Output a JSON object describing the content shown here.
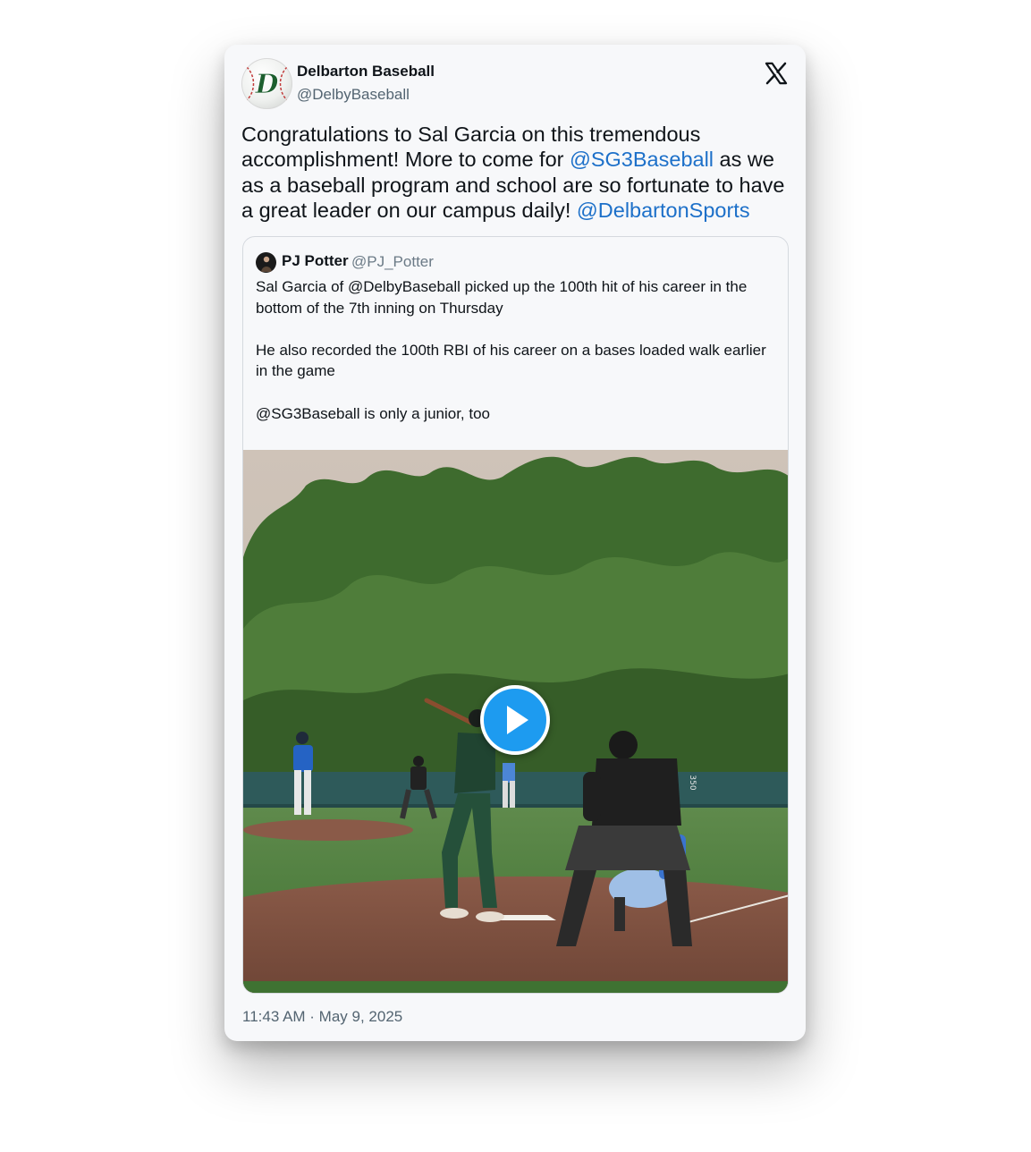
{
  "author": {
    "name": "Delbarton Baseball",
    "handle": "@DelbyBaseball",
    "avatar_icon": "delbarton-d-baseball-logo",
    "avatar_letter": "D"
  },
  "platform_icon": "x-logo-icon",
  "tweet": {
    "segments": [
      {
        "text": "Congratulations to Sal Garcia on this tremendous accomplishment! More to come for ",
        "type": "text"
      },
      {
        "text": "@SG3Baseball",
        "type": "mention"
      },
      {
        "text": " as we as a baseball program and school are so fortunate to have a great leader on our campus daily! ",
        "type": "text"
      },
      {
        "text": "@DelbartonSports",
        "type": "mention"
      }
    ]
  },
  "quoted_tweet": {
    "author_name": "PJ Potter",
    "author_handle": "@PJ_Potter",
    "paragraphs": [
      "Sal Garcia of @DelbyBaseball picked up the 100th hit of his career in the bottom of the 7th inning on Thursday",
      "He also recorded the 100th RBI of his career on a bases loaded walk earlier in the game",
      "@SG3Baseball is only a junior, too"
    ],
    "media": {
      "type": "video",
      "play_icon": "play-icon",
      "scoreboard_sign": "350"
    }
  },
  "timestamp": "11:43 AM · May 9, 2025",
  "colors": {
    "mention": "#1d70c9",
    "play_button": "#1d9bf0",
    "handle_gray": "#536471"
  }
}
